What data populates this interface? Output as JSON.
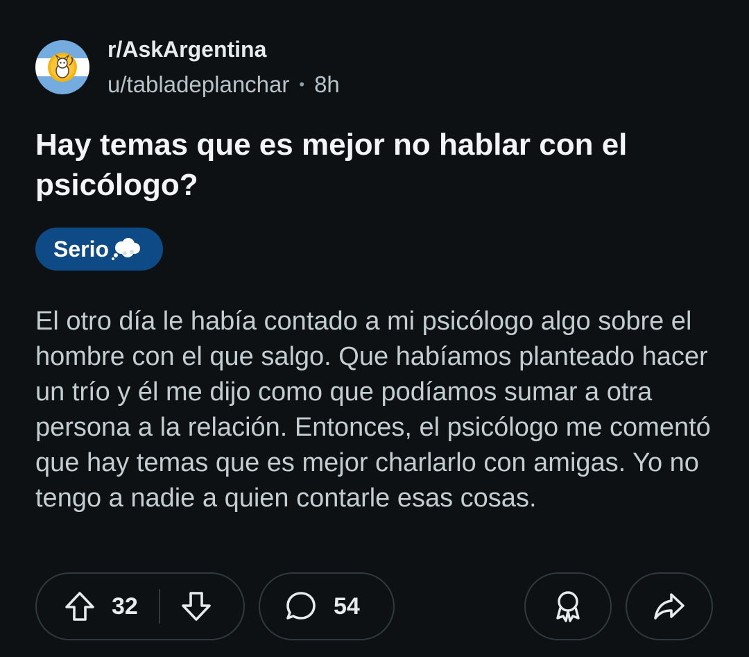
{
  "post": {
    "subreddit": "r/AskArgentina",
    "author": "u/tabladeplanchar",
    "separator": "•",
    "age": "8h",
    "title": "Hay temas que es mejor no hablar con el psicólogo?",
    "flair": {
      "label": "Serio",
      "icon": "thought-bubble-icon",
      "background": "#0d4a86"
    },
    "body": "El otro día le había contado a mi psicólogo algo sobre el hombre con el que salgo. Que habíamos planteado hacer un trío y él me dijo como que podíamos sumar a otra persona a la relación. Entonces, el psicólogo me comentó que hay temas que es mejor charlarlo con amigas. Yo no tengo a nadie a quien contarle esas cosas."
  },
  "actions": {
    "upvote_icon": "upvote-arrow-icon",
    "votes": "32",
    "downvote_icon": "downvote-arrow-icon",
    "comment_icon": "comment-bubble-icon",
    "comments": "54",
    "award_icon": "award-icon",
    "share_icon": "share-arrow-icon"
  },
  "colors": {
    "background": "#0e1113",
    "text_primary": "#f2f4f5",
    "text_secondary": "#c3cdd2",
    "pill_border": "#2f3a40"
  }
}
